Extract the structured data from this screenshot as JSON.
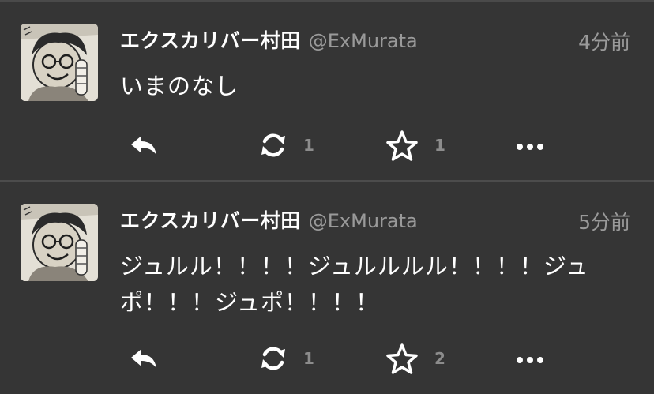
{
  "tweets": [
    {
      "display_name": "エクスカリバー村田",
      "handle": "@ExMurata",
      "time": "4分前",
      "text": "いまのなし",
      "retweet_count": "1",
      "favorite_count": "1"
    },
    {
      "display_name": "エクスカリバー村田",
      "handle": "@ExMurata",
      "time": "5分前",
      "text": "ジュルル！！！！ジュルルルル！！！！ジュポ！！！ジュポ！！！！",
      "retweet_count": "1",
      "favorite_count": "2"
    }
  ],
  "icons": {
    "reply": "reply-icon",
    "retweet": "retweet-icon",
    "favorite": "star-icon",
    "more": "more-icon"
  },
  "colors": {
    "background": "#353535",
    "divider": "#4c4c4c",
    "secondary_text": "#9a9a9a",
    "icon": "#ffffff"
  }
}
